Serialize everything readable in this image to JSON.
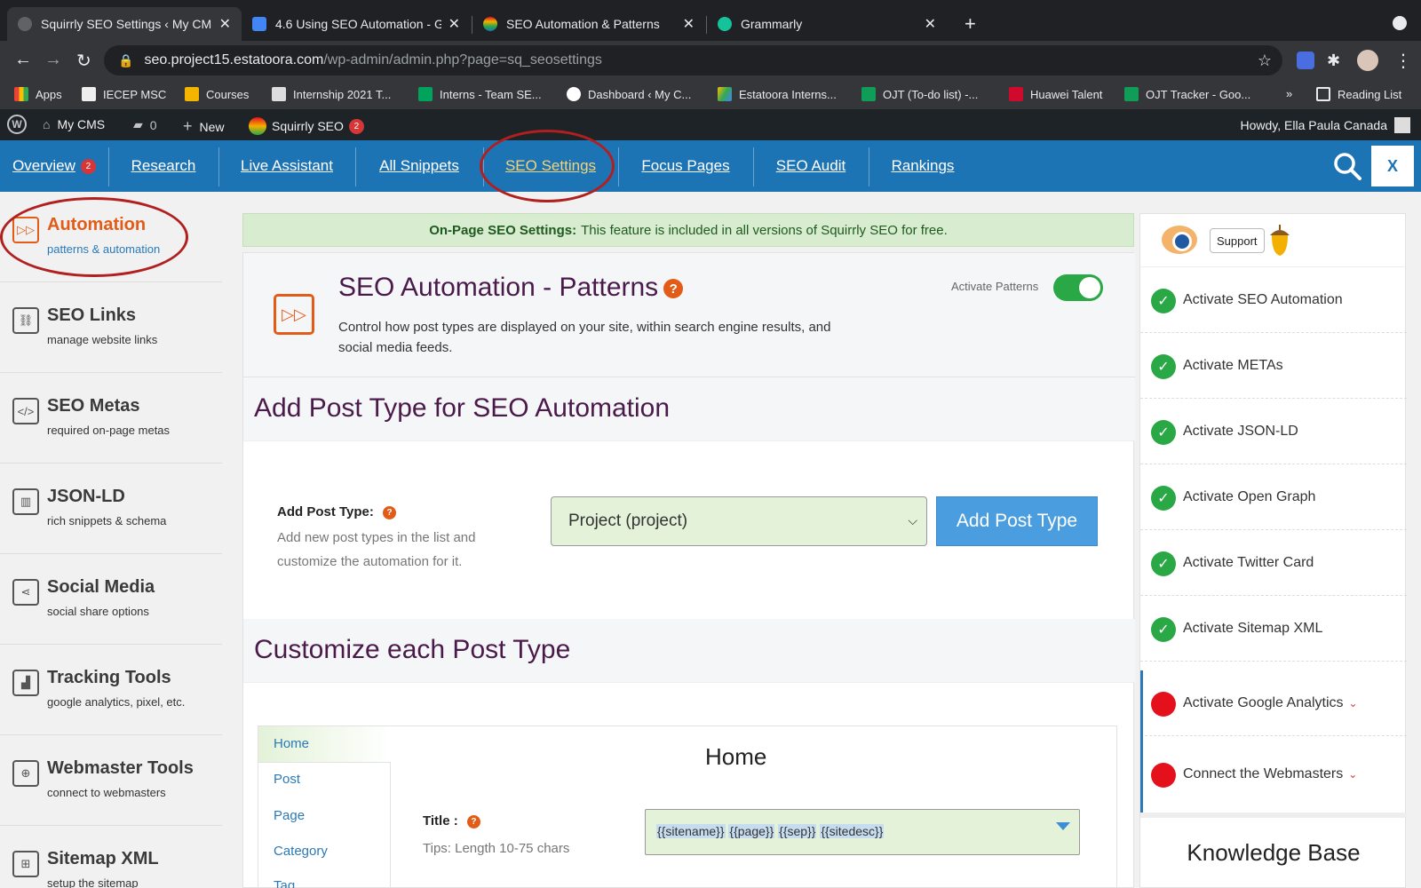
{
  "browser": {
    "tabs": [
      {
        "title": "Squirrly SEO Settings ‹ My CMS",
        "color": "#555555"
      },
      {
        "title": "4.6 Using SEO Automation - Go",
        "color": "#4285f4"
      },
      {
        "title": "SEO Automation & Patterns",
        "color": "#e25c18"
      },
      {
        "title": "Grammarly",
        "color": "#15c39a"
      }
    ],
    "url_host": "seo.project15.estatoora.com",
    "url_path": "/wp-admin/admin.php?page=sq_seosettings",
    "bookmarks": [
      "Apps",
      "IECEP MSC",
      "Courses",
      "Internship 2021 T...",
      "Interns - Team SE...",
      "Dashboard ‹ My C...",
      "Estatoora Interns...",
      "OJT (To-do list) -...",
      "Huawei Talent",
      "OJT Tracker - Goo...",
      "»",
      "Reading List"
    ]
  },
  "wpbar": {
    "site": "My CMS",
    "comments": "0",
    "new": "New",
    "plugin": "Squirrly SEO",
    "plugin_badge": "2",
    "howdy": "Howdy, Ella Paula Canada"
  },
  "pnav": {
    "items": [
      "Overview",
      "Research",
      "Live Assistant",
      "All Snippets",
      "SEO Settings",
      "Focus Pages",
      "SEO Audit",
      "Rankings"
    ],
    "overview_badge": "2",
    "close": "X"
  },
  "sidebar": {
    "items": [
      {
        "title": "Automation",
        "sub": "patterns & automation",
        "icon": "▷▷"
      },
      {
        "title": "SEO Links",
        "sub": "manage website links",
        "icon": "⛓"
      },
      {
        "title": "SEO Metas",
        "sub": "required on-page metas",
        "icon": "</>"
      },
      {
        "title": "JSON-LD",
        "sub": "rich snippets & schema",
        "icon": "▥"
      },
      {
        "title": "Social Media",
        "sub": "social share options",
        "icon": "⋖"
      },
      {
        "title": "Tracking Tools",
        "sub": "google analytics, pixel, etc.",
        "icon": "▟"
      },
      {
        "title": "Webmaster Tools",
        "sub": "connect to webmasters",
        "icon": "⊕"
      },
      {
        "title": "Sitemap XML",
        "sub": "setup the sitemap",
        "icon": "⊞"
      }
    ]
  },
  "notice": {
    "bold": "On-Page SEO Settings:",
    "text": "This feature is included in all versions of Squirrly SEO for free."
  },
  "main": {
    "title": "SEO Automation - Patterns",
    "desc": "Control how post types are displayed on your site, within search engine results, and social media feeds.",
    "activate_label": "Activate Patterns",
    "section1": "Add Post Type for SEO Automation",
    "apt_label": "Add Post Type:",
    "apt_desc": "Add new post types in the list and customize the automation for it.",
    "apt_selected": "Project (project)",
    "apt_button": "Add Post Type",
    "section2": "Customize each Post Type",
    "post_tabs": [
      "Home",
      "Post",
      "Page",
      "Category",
      "Tag"
    ],
    "pane_title": "Home",
    "title_label": "Title :",
    "title_tips": "Tips: Length 10-75 chars",
    "title_tokens": [
      "{{sitename}}",
      "{{page}}",
      "{{sep}}",
      "{{sitedesc}}"
    ]
  },
  "rside": {
    "support": "Support",
    "items": [
      {
        "label": "Activate SEO Automation",
        "status": "done"
      },
      {
        "label": "Activate METAs",
        "status": "done"
      },
      {
        "label": "Activate JSON-LD",
        "status": "done"
      },
      {
        "label": "Activate Open Graph",
        "status": "done"
      },
      {
        "label": "Activate Twitter Card",
        "status": "done"
      },
      {
        "label": "Activate Sitemap XML",
        "status": "done"
      },
      {
        "label": "Activate Google Analytics",
        "status": "todo"
      },
      {
        "label": "Connect the Webmasters",
        "status": "todo"
      }
    ],
    "kb": "Knowledge Base"
  }
}
